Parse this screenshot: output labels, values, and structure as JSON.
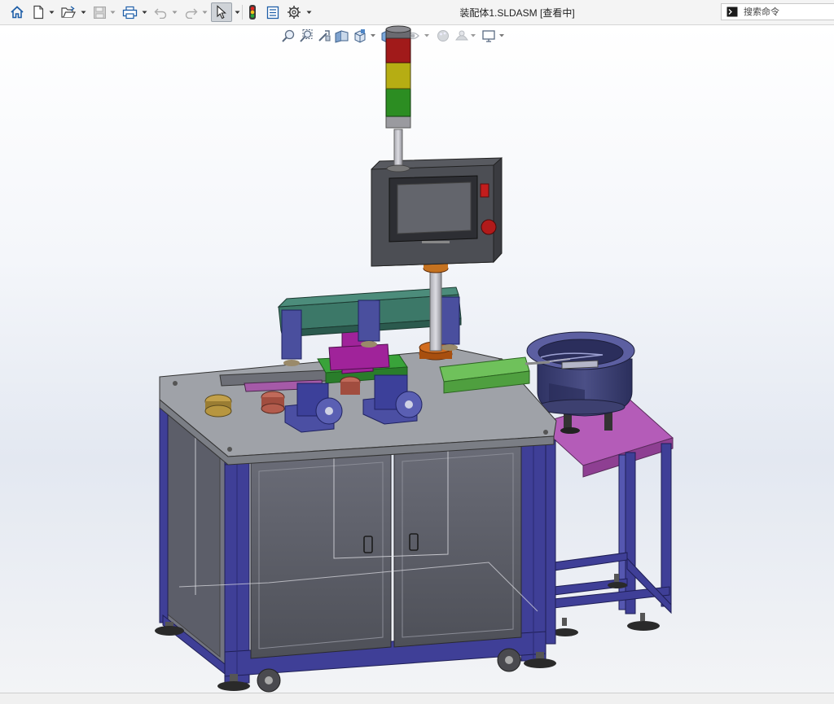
{
  "window": {
    "title": "装配体1.SLDASM [查看中]"
  },
  "toolbar": {
    "buttons": [
      {
        "name": "home",
        "icon": "home-icon"
      },
      {
        "name": "new",
        "icon": "new-document-icon"
      },
      {
        "name": "open",
        "icon": "open-folder-icon"
      },
      {
        "name": "save",
        "icon": "save-icon"
      },
      {
        "name": "print",
        "icon": "print-icon"
      },
      {
        "name": "undo",
        "icon": "undo-icon"
      },
      {
        "name": "redo",
        "icon": "redo-icon"
      },
      {
        "name": "select",
        "icon": "cursor-icon"
      },
      {
        "name": "rebuild",
        "icon": "traffic-light-icon"
      },
      {
        "name": "file-properties",
        "icon": "properties-icon"
      },
      {
        "name": "options",
        "icon": "gear-icon"
      }
    ]
  },
  "search": {
    "placeholder": "搜索命令"
  },
  "heads_up_toolbar": {
    "buttons": [
      "zoom-to-fit-icon",
      "zoom-to-area-icon",
      "previous-view-icon",
      "section-view-icon",
      "view-orientation-icon",
      "display-style-icon",
      "hide-show-items-icon",
      "edit-appearance-icon",
      "apply-scene-icon",
      "view-settings-icon"
    ]
  },
  "model": {
    "name": "assembly-model"
  },
  "colors": {
    "frame": "#3f3f97",
    "door": "#5d5f6a",
    "table_top": "#9fa2a8",
    "hmi_box": "#585a60",
    "bracket": "#3c7868",
    "magenta": "#a0239a",
    "green": "#39a33a",
    "bowl": "#393d6c",
    "stand_top": "#b45cb8",
    "tower_red": "#a11a1a",
    "tower_yellow": "#b6ad13",
    "tower_green": "#2c8d22",
    "copper": "#c25e13"
  }
}
